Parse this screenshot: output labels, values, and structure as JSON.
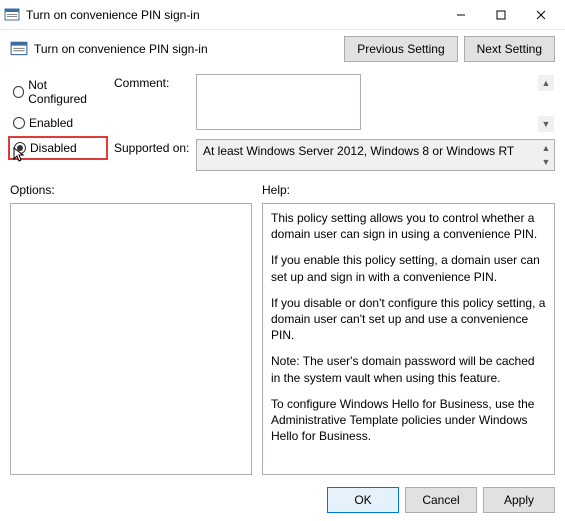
{
  "window": {
    "title": "Turn on convenience PIN sign-in"
  },
  "header": {
    "title": "Turn on convenience PIN sign-in",
    "prev": "Previous Setting",
    "next": "Next Setting"
  },
  "radios": {
    "not_configured": "Not Configured",
    "enabled": "Enabled",
    "disabled": "Disabled",
    "selected": "disabled"
  },
  "fields": {
    "comment_label": "Comment:",
    "comment_value": "",
    "supported_label": "Supported on:",
    "supported_value": "At least Windows Server 2012, Windows 8 or Windows RT"
  },
  "columns": {
    "options_label": "Options:",
    "help_label": "Help:"
  },
  "help": {
    "p1": "This policy setting allows you to control whether a domain user can sign in using a convenience PIN.",
    "p2": "If you enable this policy setting, a domain user can set up and sign in with a convenience PIN.",
    "p3": "If you disable or don't configure this policy setting, a domain user can't set up and use a convenience PIN.",
    "p4": "Note: The user's domain password will be cached in the system vault when using this feature.",
    "p5": "To configure Windows Hello for Business, use the Administrative Template policies under Windows Hello for Business."
  },
  "footer": {
    "ok": "OK",
    "cancel": "Cancel",
    "apply": "Apply"
  }
}
